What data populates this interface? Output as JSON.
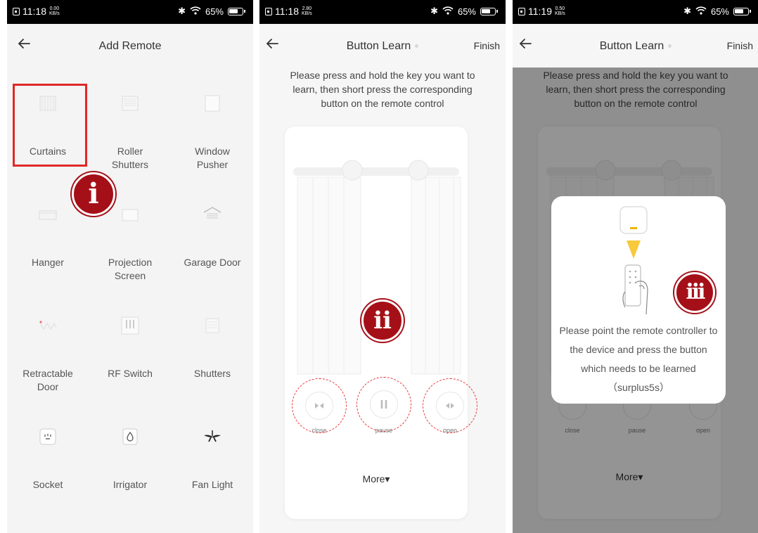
{
  "screens": [
    {
      "status": {
        "time": "11:18",
        "speed_top": "0.00",
        "speed_unit": "KB/s",
        "battery": "65%"
      },
      "nav": {
        "title": "Add Remote"
      },
      "devices": [
        {
          "label": "Curtains",
          "icon": "curtains-icon"
        },
        {
          "label": "Roller Shutters",
          "icon": "roller-shutters-icon"
        },
        {
          "label": "Window Pusher",
          "icon": "window-pusher-icon"
        },
        {
          "label": "Hanger",
          "icon": "hanger-icon"
        },
        {
          "label": "Projection Screen",
          "icon": "projection-screen-icon"
        },
        {
          "label": "Garage Door",
          "icon": "garage-door-icon"
        },
        {
          "label": "Retractable Door",
          "icon": "retractable-door-icon"
        },
        {
          "label": "RF Switch",
          "icon": "rf-switch-icon"
        },
        {
          "label": "Shutters",
          "icon": "shutters-icon"
        },
        {
          "label": "Socket",
          "icon": "socket-icon"
        },
        {
          "label": "Irrigator",
          "icon": "irrigator-icon"
        },
        {
          "label": "Fan Light",
          "icon": "fan-light-icon"
        }
      ],
      "badge": "i"
    },
    {
      "status": {
        "time": "11:18",
        "speed_top": "2.80",
        "speed_unit": "KB/s",
        "battery": "65%"
      },
      "nav": {
        "title": "Button Learn",
        "finish": "Finish"
      },
      "instruction": "Please press and hold the key you want to learn, then short press the corresponding button on the remote control",
      "controls": [
        {
          "label": "close",
          "icon": "close-curtain-icon"
        },
        {
          "label": "pause",
          "icon": "pause-icon"
        },
        {
          "label": "open",
          "icon": "open-curtain-icon"
        }
      ],
      "more": "More▾",
      "badge": "ii"
    },
    {
      "status": {
        "time": "11:19",
        "speed_top": "0.50",
        "speed_unit": "KB/s",
        "battery": "65%"
      },
      "nav": {
        "title": "Button Learn",
        "finish": "Finish"
      },
      "instruction": "Please press and hold the key you want to learn, then short press the corresponding button on the remote control",
      "controls": [
        {
          "label": "close"
        },
        {
          "label": "pause"
        },
        {
          "label": "open"
        }
      ],
      "more": "More▾",
      "dialog": {
        "text": "Please point the remote controller to the device and press the button which needs to be learned（surplus5s）"
      },
      "badge": "iii"
    }
  ],
  "colors": {
    "accent_red": "#e02828",
    "badge_red": "#a51018"
  }
}
